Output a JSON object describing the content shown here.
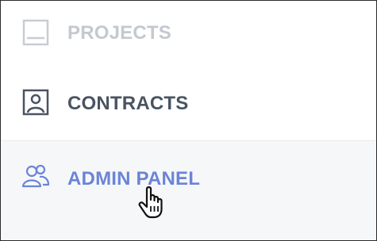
{
  "menu": {
    "items": [
      {
        "label": "PROJECTS",
        "icon": "monitor-icon",
        "state": "faded"
      },
      {
        "label": "CONTRACTS",
        "icon": "contract-user-icon",
        "state": "default"
      },
      {
        "label": "ADMIN PANEL",
        "icon": "users-icon",
        "state": "hovered"
      }
    ]
  },
  "colors": {
    "faded_text": "#c4c8cf",
    "default_text": "#4a5462",
    "hover_text": "#6b84d6",
    "hover_background": "#f6f7f9"
  },
  "cursor": {
    "icon": "hand-pointer-icon"
  }
}
